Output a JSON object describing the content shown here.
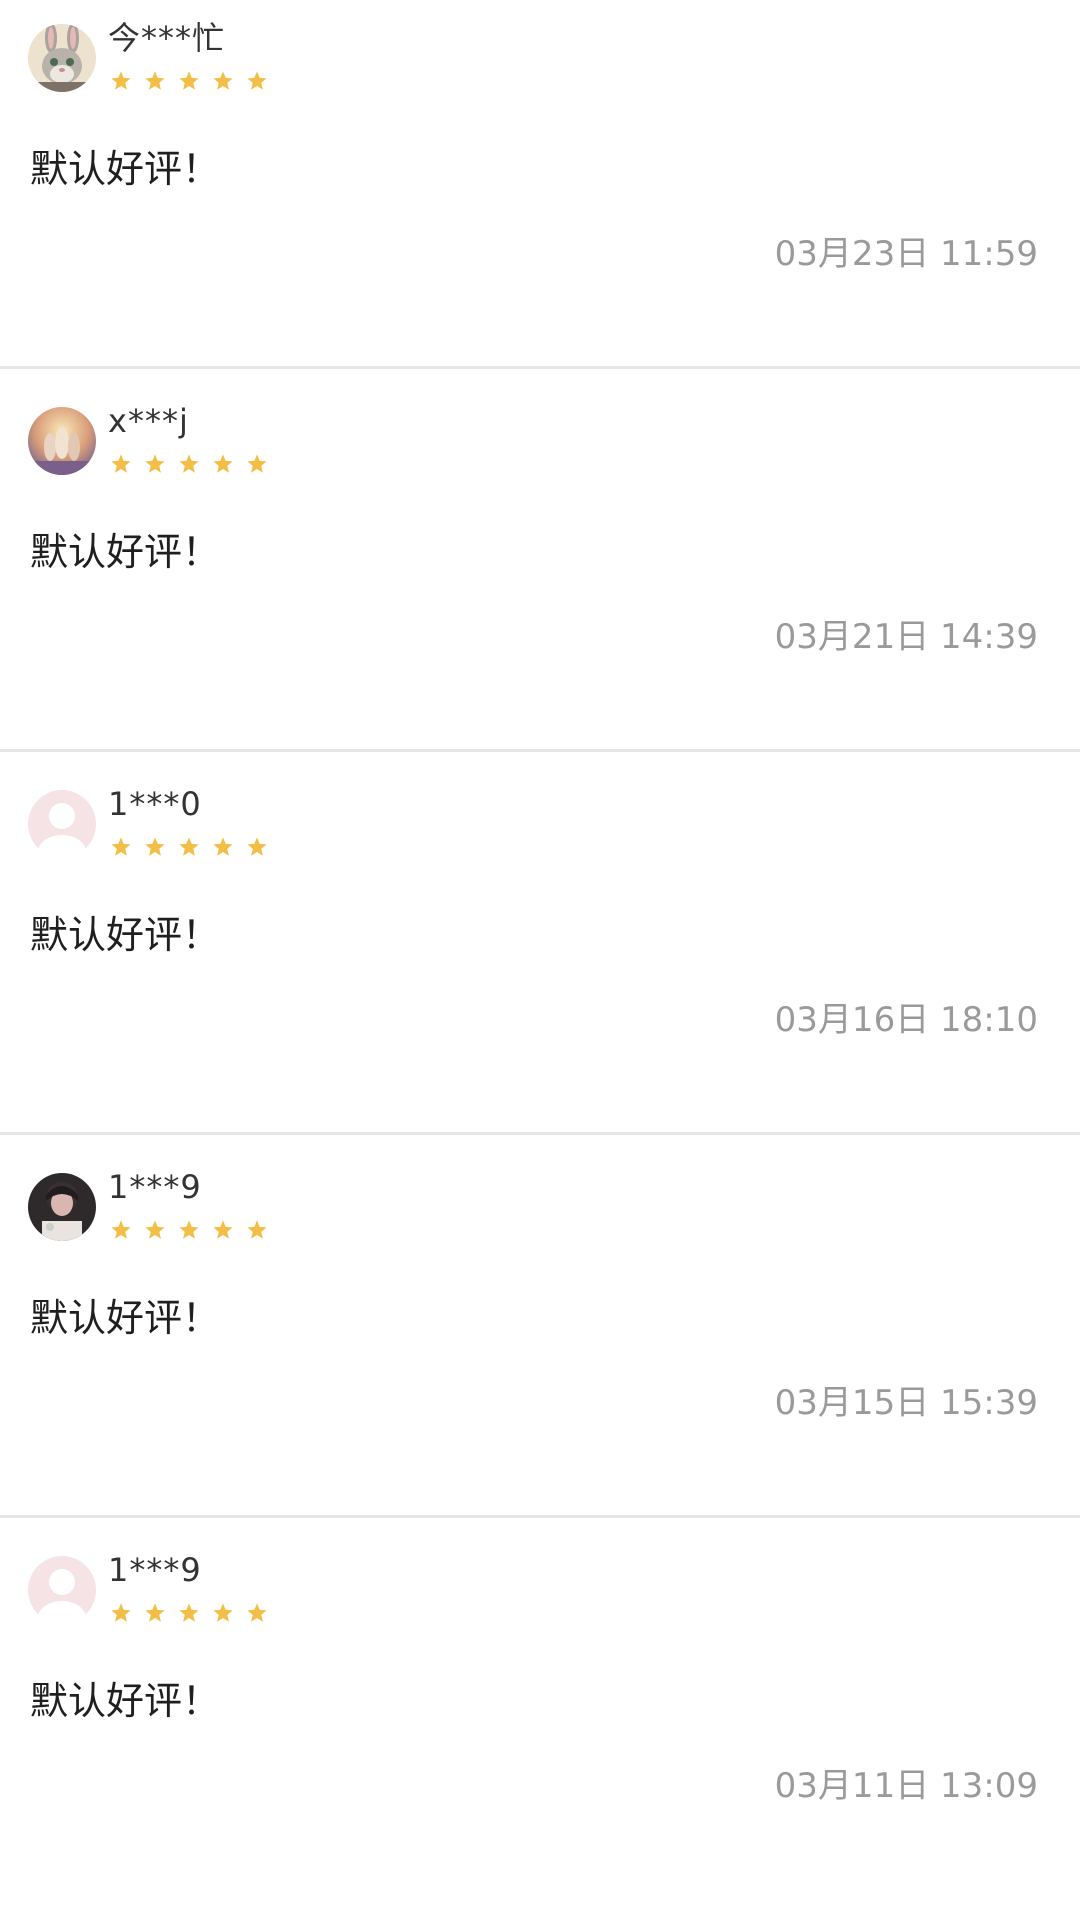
{
  "colors": {
    "star": "#F2BE45",
    "divider": "#E6E6E6",
    "timestamp": "#9A9A9A",
    "default_avatar_bg": "#F3D9DC"
  },
  "reviews": [
    {
      "username": "今***忙",
      "avatar": "bunny-avatar",
      "rating": 5,
      "text": "默认好评！",
      "timestamp": "03月23日 11:59"
    },
    {
      "username": "x***j",
      "avatar": "photo-avatar",
      "rating": 5,
      "text": "默认好评！",
      "timestamp": "03月21日 14:39"
    },
    {
      "username": "1***0",
      "avatar": "default-avatar",
      "rating": 5,
      "text": "默认好评！",
      "timestamp": "03月16日 18:10"
    },
    {
      "username": "1***9",
      "avatar": "portrait-avatar",
      "rating": 5,
      "text": "默认好评！",
      "timestamp": "03月15日 15:39"
    },
    {
      "username": "1***9",
      "avatar": "default-avatar",
      "rating": 5,
      "text": "默认好评！",
      "timestamp": "03月11日 13:09"
    }
  ]
}
